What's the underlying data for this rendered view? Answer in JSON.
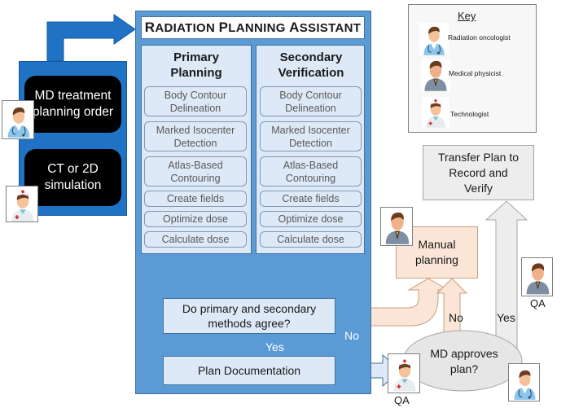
{
  "diagram": {
    "title": "Radiation Planning Assistant",
    "left_panel": {
      "boxes": [
        {
          "label": "MD treatment planning order",
          "role": "radiation-oncologist"
        },
        {
          "label": "CT or 2D simulation",
          "role": "technologist"
        }
      ]
    },
    "columns": [
      {
        "heading": "Primary Planning",
        "steps": [
          "Body Contour Delineation",
          "Marked Isocenter Detection",
          "Atlas-Based Contouring",
          "Create fields",
          "Optimize dose",
          "Calculate dose"
        ]
      },
      {
        "heading": "Secondary Verification",
        "steps": [
          "Body Contour Delineation",
          "Marked Isocenter Detection",
          "Atlas-Based Contouring",
          "Create fields",
          "Optimize dose",
          "Calculate dose"
        ]
      }
    ],
    "decision_agree": "Do primary and secondary methods agree?",
    "plan_documentation": "Plan Documentation",
    "md_approves": "MD approves plan?",
    "manual_planning": "Manual planning",
    "transfer": "Transfer Plan to Record and Verify",
    "labels": {
      "yes": "Yes",
      "no": "No",
      "qa": "QA"
    },
    "key": {
      "title": "Key",
      "items": [
        {
          "label": "Radiation oncologist",
          "icon": "radiation-oncologist-icon"
        },
        {
          "label": "Medical physicist",
          "icon": "medical-physicist-icon"
        },
        {
          "label": "Technologist",
          "icon": "technologist-icon"
        }
      ]
    },
    "colors": {
      "dark_blue": "#1f72c4",
      "mid_blue": "#5b9bd5",
      "light_blue": "#dde9f6",
      "peach": "#fbe5d6",
      "gray": "#ededed",
      "black": "#000000"
    }
  }
}
